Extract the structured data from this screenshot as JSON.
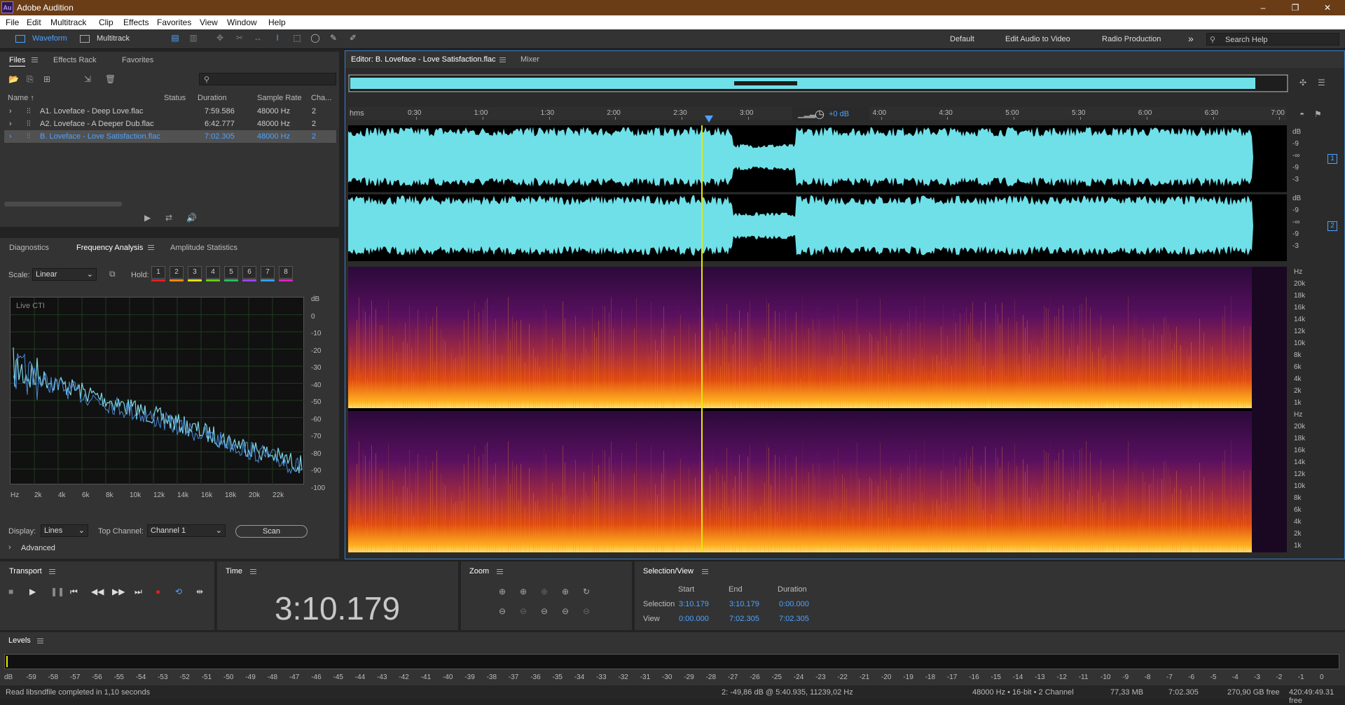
{
  "window": {
    "title": "Adobe Audition",
    "logo": "Au",
    "minimize": "–",
    "restore": "❐",
    "close": "✕"
  },
  "menu": [
    "File",
    "Edit",
    "Multitrack",
    "Clip",
    "Effects",
    "Favorites",
    "View",
    "Window",
    "Help"
  ],
  "toolbar": {
    "waveform": "Waveform",
    "multitrack": "Multitrack",
    "ws1": "Default",
    "ws2": "Edit Audio to Video",
    "ws3": "Radio Production",
    "more": "»",
    "search_placeholder": "Search Help"
  },
  "files_panel": {
    "tabs": [
      "Files",
      "Effects Rack",
      "Favorites"
    ],
    "columns": [
      "Name ↑",
      "Status",
      "Duration",
      "Sample Rate",
      "Cha..."
    ],
    "rows": [
      {
        "name": "A1. Loveface - Deep Love.flac",
        "duration": "7:59.586",
        "rate": "48000 Hz",
        "ch": "2"
      },
      {
        "name": "A2. Loveface - A Deeper Dub.flac",
        "duration": "6:42.777",
        "rate": "48000 Hz",
        "ch": "2"
      },
      {
        "name": "B. Loveface - Love Satisfaction.flac",
        "duration": "7:02.305",
        "rate": "48000 Hz",
        "ch": "2"
      }
    ]
  },
  "analysis_panel": {
    "tabs": [
      "Diagnostics",
      "Frequency Analysis",
      "Amplitude Statistics"
    ],
    "scale_label": "Scale:",
    "scale_value": "Linear",
    "hold_label": "Hold:",
    "holds": [
      "1",
      "2",
      "3",
      "4",
      "5",
      "6",
      "7",
      "8"
    ],
    "hold_colors": [
      "#e02020",
      "#f08c00",
      "#e8e000",
      "#60d000",
      "#20c060",
      "#a040ff",
      "#30a0ff",
      "#e020c0"
    ],
    "live": "Live CTI",
    "db_ticks": [
      "dB",
      "0",
      "-10",
      "-20",
      "-30",
      "-40",
      "-50",
      "-60",
      "-70",
      "-80",
      "-90",
      "-100"
    ],
    "hz_ticks": [
      "Hz",
      "2k",
      "4k",
      "6k",
      "8k",
      "10k",
      "12k",
      "14k",
      "16k",
      "18k",
      "20k",
      "22k"
    ],
    "display_label": "Display:",
    "display_value": "Lines",
    "top_label": "Top Channel:",
    "top_value": "Channel 1",
    "scan": "Scan",
    "advanced": "Advanced"
  },
  "editor": {
    "tab": "Editor: B. Loveface - Love Satisfaction.flac",
    "mixer": "Mixer",
    "ruler_unit": "hms",
    "ruler": [
      "0:30",
      "1:00",
      "1:30",
      "2:00",
      "2:30",
      "3:00",
      "3:30",
      "4:00",
      "4:30",
      "5:00",
      "5:30",
      "6:00",
      "6:30",
      "7:00"
    ],
    "gain": "+0 dB",
    "wave_db": [
      "dB",
      "-9",
      "-∞",
      "-9",
      "-3"
    ],
    "channels": [
      "1",
      "2"
    ],
    "spec_hz": [
      "Hz",
      "20k",
      "18k",
      "16k",
      "14k",
      "12k",
      "10k",
      "8k",
      "6k",
      "4k",
      "2k",
      "1k"
    ]
  },
  "transport": {
    "title": "Transport"
  },
  "time": {
    "title": "Time",
    "value": "3:10.179"
  },
  "zoom": {
    "title": "Zoom"
  },
  "selection": {
    "title": "Selection/View",
    "start": "Start",
    "end": "End",
    "duration": "Duration",
    "sel_label": "Selection",
    "sel_start": "3:10.179",
    "sel_end": "3:10.179",
    "sel_dur": "0:00.000",
    "view_label": "View",
    "view_start": "0:00.000",
    "view_end": "7:02.305",
    "view_dur": "7:02.305"
  },
  "levels": {
    "title": "Levels",
    "scale": [
      "dB",
      "-59",
      "-58",
      "-57",
      "-56",
      "-55",
      "-54",
      "-53",
      "-52",
      "-51",
      "-50",
      "-49",
      "-48",
      "-47",
      "-46",
      "-45",
      "-44",
      "-43",
      "-42",
      "-41",
      "-40",
      "-39",
      "-38",
      "-37",
      "-36",
      "-35",
      "-34",
      "-33",
      "-32",
      "-31",
      "-30",
      "-29",
      "-28",
      "-27",
      "-26",
      "-25",
      "-24",
      "-23",
      "-22",
      "-21",
      "-20",
      "-19",
      "-18",
      "-17",
      "-16",
      "-15",
      "-14",
      "-13",
      "-12",
      "-11",
      "-10",
      "-9",
      "-8",
      "-7",
      "-6",
      "-5",
      "-4",
      "-3",
      "-2",
      "-1",
      "0"
    ]
  },
  "status": {
    "left": "Read libsndfile completed in 1,10 seconds",
    "cursor": "2: -49,86 dB @ 5:40.935, 11239,02 Hz",
    "format": "48000 Hz • 16-bit • 2 Channel",
    "size": "77,33 MB",
    "dur": "7:02.305",
    "free": "270,90 GB free",
    "free_time": "420:49:49.31 free"
  },
  "colors": {
    "accent": "#4da3ff",
    "waveform": "#6fe0e8",
    "playhead": "#e8e800"
  }
}
